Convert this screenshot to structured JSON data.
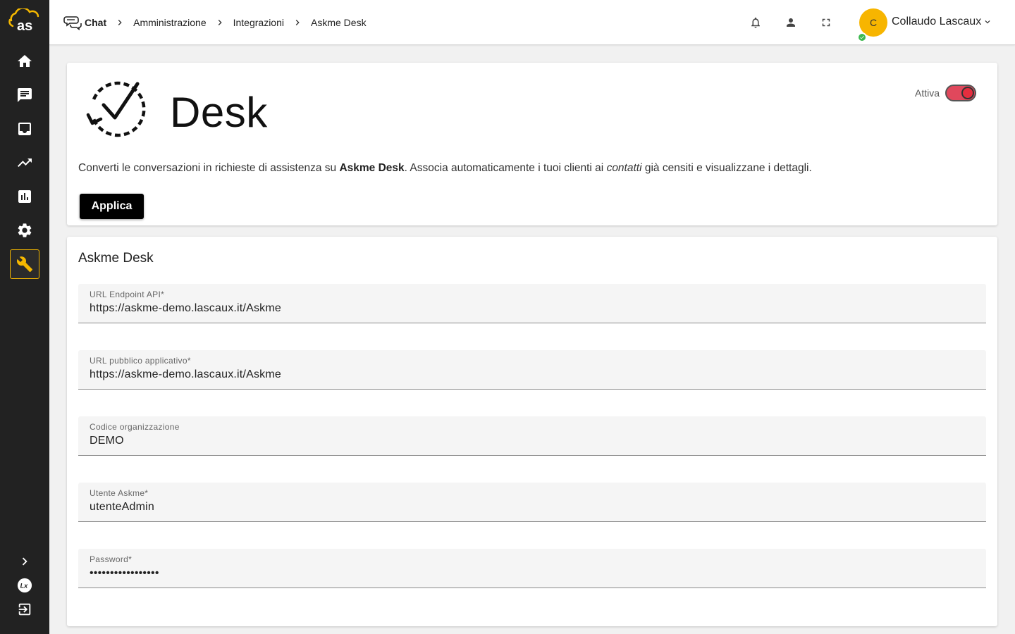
{
  "sidebar": {
    "logo_text": "as",
    "items": [
      {
        "name": "home-icon"
      },
      {
        "name": "chat-icon"
      },
      {
        "name": "inbox-icon"
      },
      {
        "name": "trending-icon"
      },
      {
        "name": "bar-chart-icon"
      },
      {
        "name": "gear-icon"
      },
      {
        "name": "wrench-icon",
        "active": true
      }
    ],
    "bottom": [
      {
        "name": "chevron-right-icon"
      },
      {
        "name": "lx-logo-icon"
      },
      {
        "name": "logout-icon"
      }
    ],
    "accent": "#f5b800"
  },
  "header": {
    "breadcrumb": [
      "Chat",
      "Amministrazione",
      "Integrazioni",
      "Askme Desk"
    ],
    "icons": [
      "bell-icon",
      "person-icon",
      "fullscreen-icon"
    ],
    "user": {
      "initial": "C",
      "name": "Collaudo Lascaux",
      "status_color": "#3fb950",
      "avatar_color": "#f7b500"
    }
  },
  "integration": {
    "title": "Desk",
    "toggle_label": "Attiva",
    "toggle_on": true,
    "desc_part1": "Converti le conversazioni in richieste di assistenza su ",
    "desc_bold": "Askme Desk",
    "desc_part2": ". Associa automaticamente i tuoi clienti ai ",
    "desc_italic": "contatti",
    "desc_part3": " già censiti e visualizzane i dettagli.",
    "apply_label": "Applica"
  },
  "form": {
    "title": "Askme Desk",
    "fields": [
      {
        "label": "URL Endpoint API*",
        "value": "https://askme-demo.lascaux.it/Askme"
      },
      {
        "label": "URL pubblico applicativo*",
        "value": "https://askme-demo.lascaux.it/Askme"
      },
      {
        "label": "Codice organizzazione",
        "value": "DEMO"
      },
      {
        "label": "Utente Askme*",
        "value": "utenteAdmin"
      },
      {
        "label": "Password*",
        "value": "•••••••••••••••••"
      }
    ]
  }
}
